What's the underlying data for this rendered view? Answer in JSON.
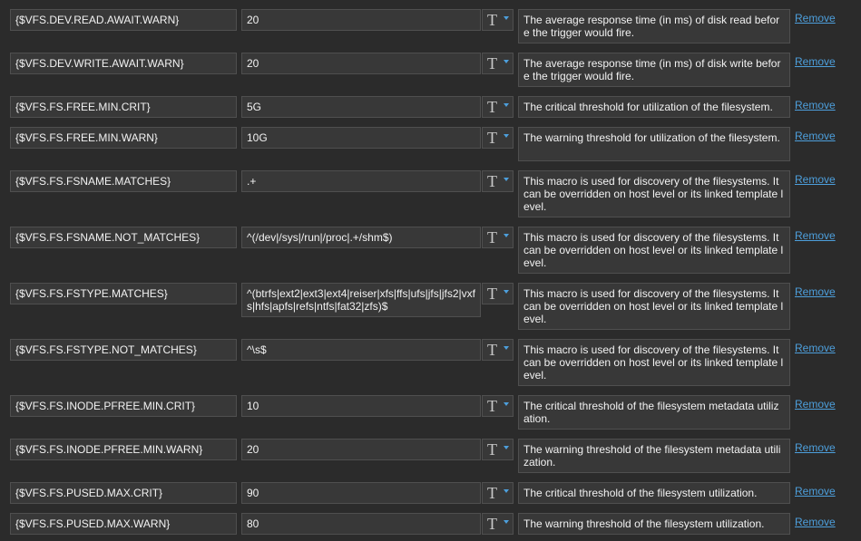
{
  "type_button": {
    "glyph": "T"
  },
  "macros": [
    {
      "name": "{$VFS.DEV.READ.AWAIT.WARN}",
      "value": "20",
      "description": "The average response time (in ms) of disk read before the trigger would fire.",
      "remove": "Remove"
    },
    {
      "name": "{$VFS.DEV.WRITE.AWAIT.WARN}",
      "value": "20",
      "description": "The average response time (in ms) of disk write before the trigger would fire.",
      "remove": "Remove"
    },
    {
      "name": "{$VFS.FS.FREE.MIN.CRIT}",
      "value": "5G",
      "description": "The critical threshold for utilization of the filesystem.",
      "remove": "Remove"
    },
    {
      "name": "{$VFS.FS.FREE.MIN.WARN}",
      "value": "10G",
      "description": "The warning threshold for utilization of the filesystem.",
      "remove": "Remove"
    },
    {
      "name": "{$VFS.FS.FSNAME.MATCHES}",
      "value": ".+",
      "description": "This macro is used for discovery of the filesystems. It can be overridden on host level or its linked template level.",
      "remove": "Remove"
    },
    {
      "name": "{$VFS.FS.FSNAME.NOT_MATCHES}",
      "value": "^(/dev|/sys|/run|/proc|.+/shm$)",
      "description": "This macro is used for discovery of the filesystems. It can be overridden on host level or its linked template level.",
      "remove": "Remove"
    },
    {
      "name": "{$VFS.FS.FSTYPE.MATCHES}",
      "value": "^(btrfs|ext2|ext3|ext4|reiser|xfs|ffs|ufs|jfs|jfs2|vxfs|hfs|apfs|refs|ntfs|fat32|zfs)$",
      "description": "This macro is used for discovery of the filesystems. It can be overridden on host level or its linked template level.",
      "remove": "Remove"
    },
    {
      "name": "{$VFS.FS.FSTYPE.NOT_MATCHES}",
      "value": "^\\s$",
      "description": "This macro is used for discovery of the filesystems. It can be overridden on host level or its linked template level.",
      "remove": "Remove"
    },
    {
      "name": "{$VFS.FS.INODE.PFREE.MIN.CRIT}",
      "value": "10",
      "description": "The critical threshold of the filesystem metadata utilization.",
      "remove": "Remove"
    },
    {
      "name": "{$VFS.FS.INODE.PFREE.MIN.WARN}",
      "value": "20",
      "description": "The warning threshold of the filesystem metadata utilization.",
      "remove": "Remove"
    },
    {
      "name": "{$VFS.FS.PUSED.MAX.CRIT}",
      "value": "90",
      "description": "The critical threshold of the filesystem utilization.",
      "remove": "Remove"
    },
    {
      "name": "{$VFS.FS.PUSED.MAX.WARN}",
      "value": "80",
      "description": "The warning threshold of the filesystem utilization.",
      "remove": "Remove"
    }
  ]
}
